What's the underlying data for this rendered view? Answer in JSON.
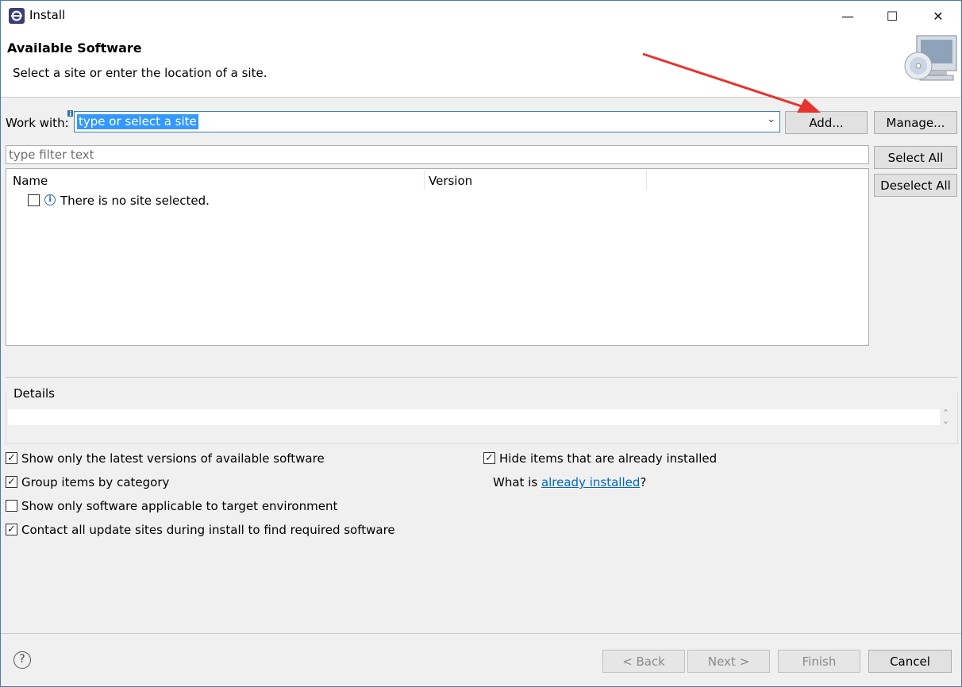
{
  "window": {
    "title": "Install",
    "app_icon": "eclipse-icon",
    "controls": {
      "minimize": "—",
      "maximize": "☐",
      "close": "✕"
    }
  },
  "banner": {
    "title": "Available Software",
    "description": "Select a site or enter the location of a site."
  },
  "work_with": {
    "label": "Work with:",
    "value": "type or select a site",
    "add_button": "Add...",
    "manage_button": "Manage..."
  },
  "filter": {
    "placeholder": "type filter text"
  },
  "selection_buttons": {
    "select_all": "Select All",
    "deselect_all": "Deselect All"
  },
  "table": {
    "columns": [
      "Name",
      "Version"
    ],
    "rows": [
      {
        "checked": false,
        "icon": "info-icon",
        "text": "There is no site selected."
      }
    ]
  },
  "details": {
    "label": "Details",
    "value": ""
  },
  "options": {
    "latest_versions": {
      "label": "Show only the latest versions of available software",
      "checked": true
    },
    "group_by_category": {
      "label": "Group items by category",
      "checked": true
    },
    "target_environment": {
      "label": "Show only software applicable to target environment",
      "checked": false
    },
    "contact_sites": {
      "label": "Contact all update sites during install to find required software",
      "checked": true
    },
    "hide_installed": {
      "label": "Hide items that are already installed",
      "checked": true
    },
    "what_is_prefix": "What is ",
    "what_is_link": "already installed",
    "what_is_suffix": "?"
  },
  "footer": {
    "back": "< Back",
    "next": "Next >",
    "finish": "Finish",
    "cancel": "Cancel"
  },
  "colors": {
    "selection": "#3399ff",
    "link": "#0066cc",
    "annotation_arrow": "#e8322d"
  }
}
